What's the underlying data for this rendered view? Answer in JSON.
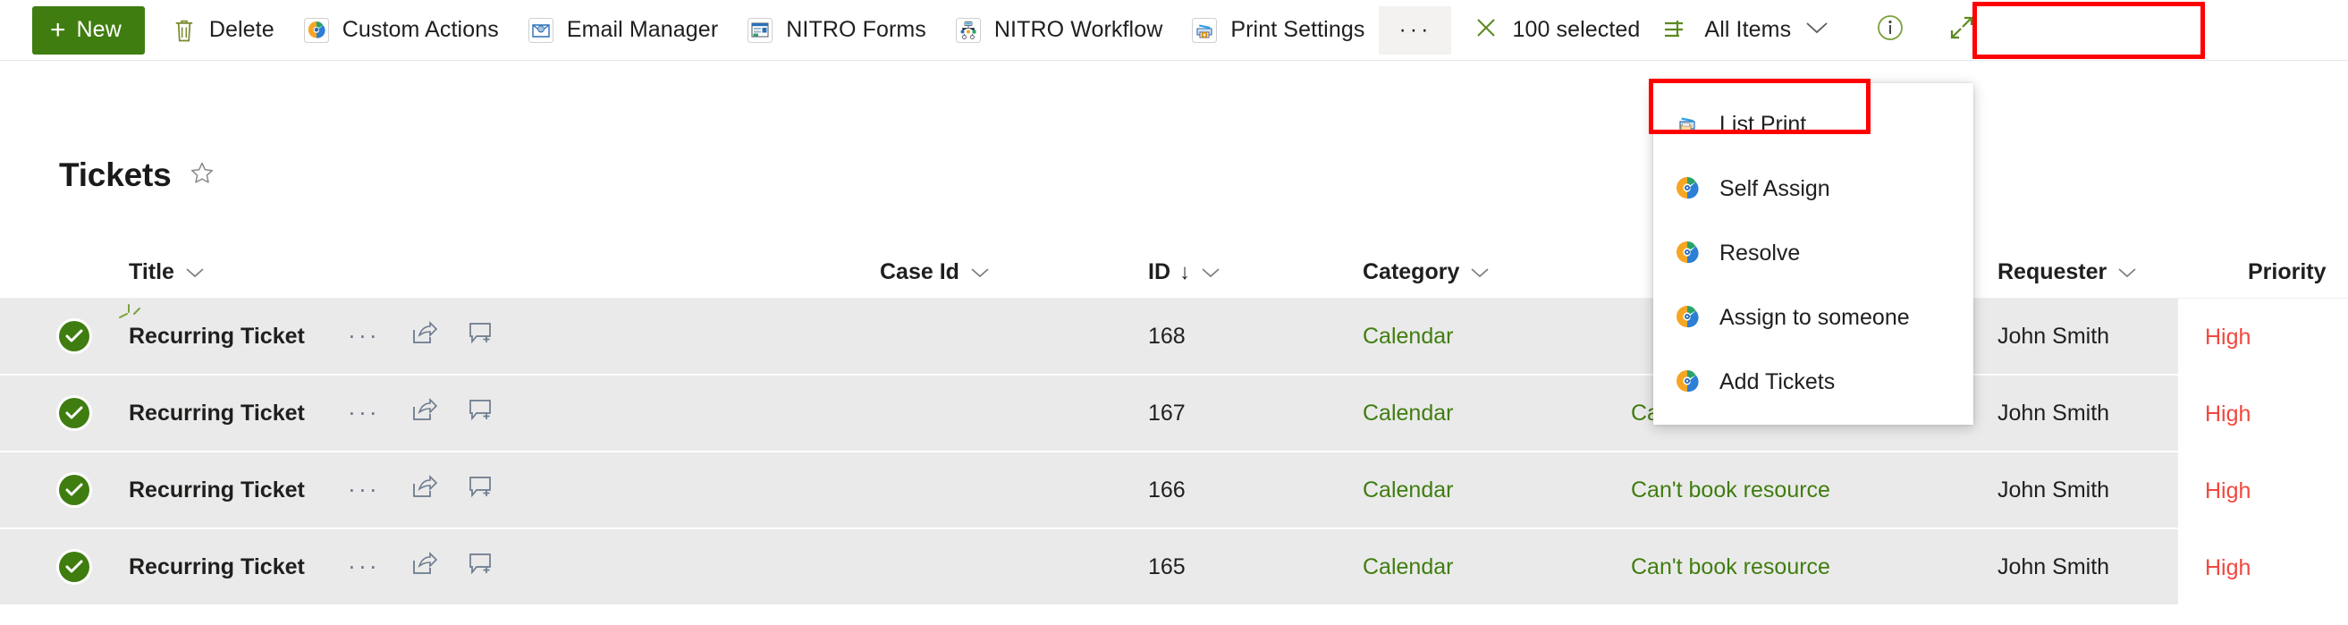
{
  "toolbar": {
    "new_label": "New",
    "items": [
      {
        "label": "Delete",
        "icon": "trash-icon"
      },
      {
        "label": "Custom Actions",
        "icon": "custom-actions-icon"
      },
      {
        "label": "Email Manager",
        "icon": "email-manager-icon"
      },
      {
        "label": "NITRO Forms",
        "icon": "nitro-forms-icon"
      },
      {
        "label": "NITRO Workflow",
        "icon": "nitro-workflow-icon"
      },
      {
        "label": "Print Settings",
        "icon": "print-settings-icon"
      }
    ],
    "overflow_label": "···",
    "selected_label": "100 selected",
    "view_label": "All Items",
    "info_icon": "info-icon",
    "expand_icon": "expand-icon",
    "close_selection_icon": "close-icon",
    "view_list_icon": "view-list-icon"
  },
  "header": {
    "title": "Tickets",
    "favorite_icon": "star-outline-icon"
  },
  "menu": {
    "items": [
      {
        "label": "List Print",
        "icon": "list-print-icon",
        "highlighted": true
      },
      {
        "label": "Self Assign",
        "icon": "target-icon",
        "highlighted": false
      },
      {
        "label": "Resolve",
        "icon": "target-icon",
        "highlighted": false
      },
      {
        "label": "Assign to someone",
        "icon": "target-icon",
        "highlighted": false
      },
      {
        "label": "Add Tickets",
        "icon": "target-icon",
        "highlighted": false
      }
    ]
  },
  "table": {
    "columns": [
      {
        "key": "title",
        "label": "Title",
        "sort": ""
      },
      {
        "key": "case_id",
        "label": "Case Id",
        "sort": ""
      },
      {
        "key": "id",
        "label": "ID",
        "sort": "↓"
      },
      {
        "key": "category",
        "label": "Category",
        "sort": ""
      },
      {
        "key": "desc",
        "label": "",
        "sort": ""
      },
      {
        "key": "requester",
        "label": "Requester",
        "sort": ""
      },
      {
        "key": "priority",
        "label": "Priority",
        "sort": ""
      }
    ],
    "rows": [
      {
        "selected": true,
        "new_flag": true,
        "title": "Recurring Ticket",
        "case_id": "",
        "id": "168",
        "category": "Calendar",
        "desc": "",
        "requester": "John Smith",
        "priority": "High"
      },
      {
        "selected": true,
        "new_flag": false,
        "title": "Recurring Ticket",
        "case_id": "",
        "id": "167",
        "category": "Calendar",
        "desc": "Can't book resource",
        "requester": "John Smith",
        "priority": "High"
      },
      {
        "selected": true,
        "new_flag": false,
        "title": "Recurring Ticket",
        "case_id": "",
        "id": "166",
        "category": "Calendar",
        "desc": "Can't book resource",
        "requester": "John Smith",
        "priority": "High"
      },
      {
        "selected": true,
        "new_flag": false,
        "title": "Recurring Ticket",
        "case_id": "",
        "id": "165",
        "category": "Calendar",
        "desc": "Can't book resource",
        "requester": "John Smith",
        "priority": "High"
      }
    ],
    "row_action_icons": [
      "more-actions-icon",
      "share-icon",
      "add-comment-icon"
    ]
  },
  "colors": {
    "primary_green": "#3f7d10",
    "link_green": "#3f7d10",
    "priority_high_red": "#f0483e",
    "highlight_red": "#ff0000",
    "row_bg": "#ebeaea"
  }
}
